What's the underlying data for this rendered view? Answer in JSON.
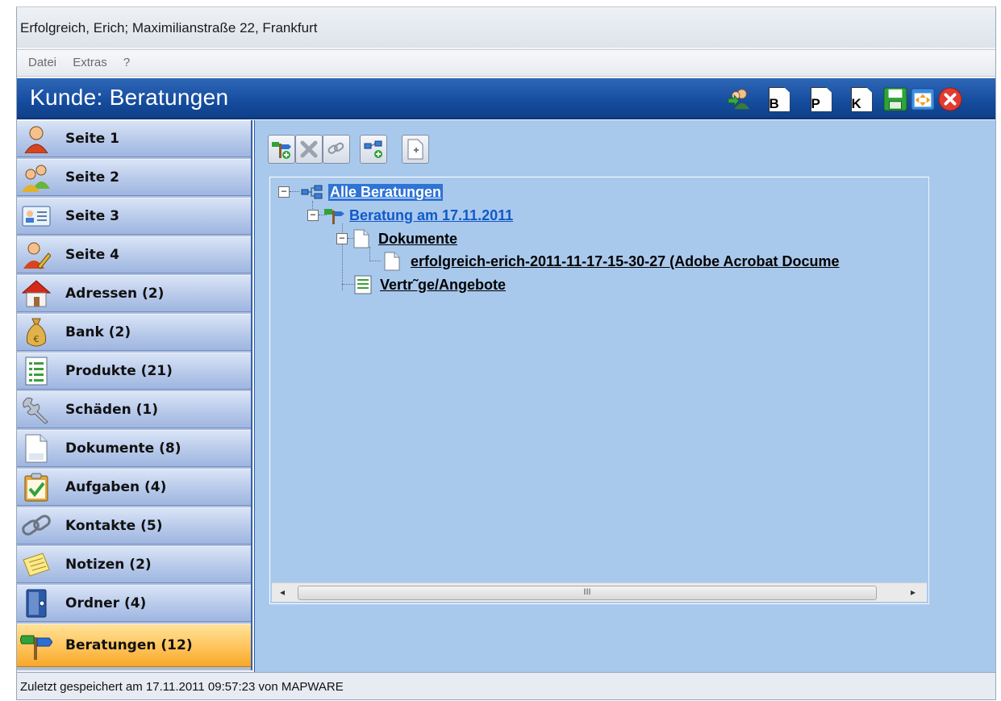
{
  "window": {
    "title": "Erfolgreich, Erich; Maximilianstraße 22, Frankfurt"
  },
  "menu": {
    "items": [
      "Datei",
      "Extras",
      "?"
    ]
  },
  "header": {
    "title": "Kunde: Beratungen",
    "toolbar": {
      "b_label": "B",
      "p_label": "P",
      "k_label": "K"
    }
  },
  "sidebar": {
    "items": [
      {
        "label": "Seite 1",
        "icon": "person-icon"
      },
      {
        "label": "Seite 2",
        "icon": "people-icon"
      },
      {
        "label": "Seite 3",
        "icon": "id-card-icon"
      },
      {
        "label": "Seite 4",
        "icon": "person-edit-icon"
      },
      {
        "label": "Adressen (2)",
        "icon": "house-icon"
      },
      {
        "label": "Bank (2)",
        "icon": "money-bag-icon"
      },
      {
        "label": "Produkte (21)",
        "icon": "list-document-icon"
      },
      {
        "label": "Schäden (1)",
        "icon": "wrench-icon"
      },
      {
        "label": "Dokumente (8)",
        "icon": "document-icon"
      },
      {
        "label": "Aufgaben (4)",
        "icon": "clipboard-check-icon"
      },
      {
        "label": "Kontakte (5)",
        "icon": "chain-link-icon"
      },
      {
        "label": "Notizen (2)",
        "icon": "note-icon"
      },
      {
        "label": "Ordner (4)",
        "icon": "binder-icon"
      },
      {
        "label": "Beratungen (12)",
        "icon": "signpost-icon",
        "active": true
      }
    ]
  },
  "tree": {
    "root": "Alle Beratungen",
    "consultation": "Beratung am 17.11.2011",
    "documents": "Dokumente",
    "document_file": "erfolgreich-erich-2011-11-17-15-30-27 (Adobe Acrobat Docume",
    "contracts": "Vertr˜ge/Angebote",
    "expanded_symbol": "−"
  },
  "scrollbar": {
    "grip": "III",
    "left_arrow": "◂",
    "right_arrow": "▸"
  },
  "status": {
    "text": "Zuletzt gespeichert am 17.11.2011 09:57:23 von MAPWARE"
  },
  "colors": {
    "header_blue": "#154c9e",
    "content_bg": "#a9c9ec",
    "active_orange": "#ffc35a",
    "link_blue": "#1259c9",
    "close_red": "#e23b2f",
    "save_green": "#2fa33a"
  }
}
